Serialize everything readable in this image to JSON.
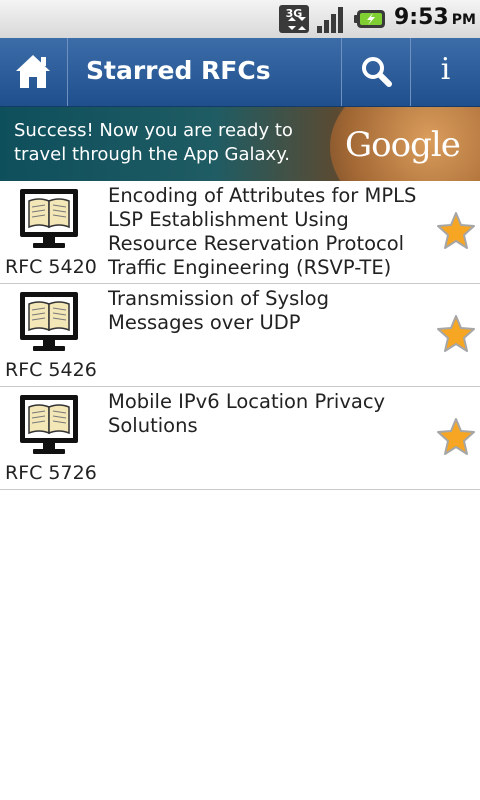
{
  "status_bar": {
    "network_type": "3G",
    "network_icon": "3g-data-icon",
    "signal_icon": "signal-bars-icon",
    "battery_icon": "battery-charging-icon",
    "time": "9:53",
    "ampm": "PM"
  },
  "title_bar": {
    "title": "Starred RFCs",
    "home_icon": "home-icon",
    "search_icon": "search-icon",
    "info_label": "i",
    "color": "#2a5a96"
  },
  "ad": {
    "text": "Success! Now you are ready to travel through the App Galaxy.",
    "logo_text": "Google"
  },
  "rfcs": [
    {
      "number": "RFC 5420",
      "title": "Encoding of Attributes for MPLS LSP Establishment Using Resource Reservation Protocol Traffic Engineering (RSVP-TE)",
      "starred": true
    },
    {
      "number": "RFC 5426",
      "title": "Transmission of Syslog Messages over UDP",
      "starred": true
    },
    {
      "number": "RFC 5726",
      "title": "Mobile IPv6 Location Privacy Solutions",
      "starred": true
    }
  ],
  "colors": {
    "star": "#f6a623",
    "accent": "#2a5a96"
  }
}
